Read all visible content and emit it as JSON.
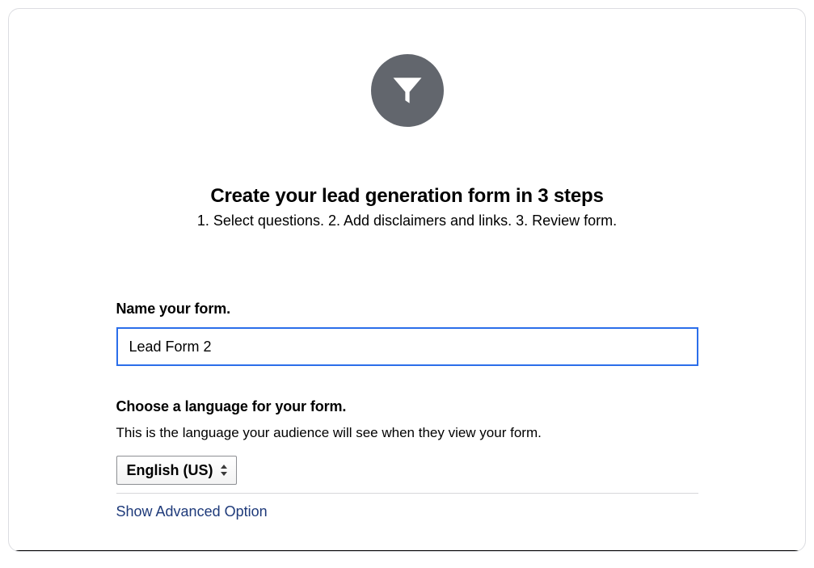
{
  "header": {
    "title": "Create your lead generation form in 3 steps",
    "subtitle": "1. Select questions. 2. Add disclaimers and links. 3. Review form."
  },
  "form": {
    "name_label": "Name your form.",
    "name_value": "Lead Form 2",
    "language_label": "Choose a language for your form.",
    "language_help": "This is the language your audience will see when they view your form.",
    "language_selected": "English (US)",
    "advanced_link": "Show Advanced Option"
  },
  "icons": {
    "funnel": "funnel-icon",
    "select_caret": "sort-icon"
  }
}
